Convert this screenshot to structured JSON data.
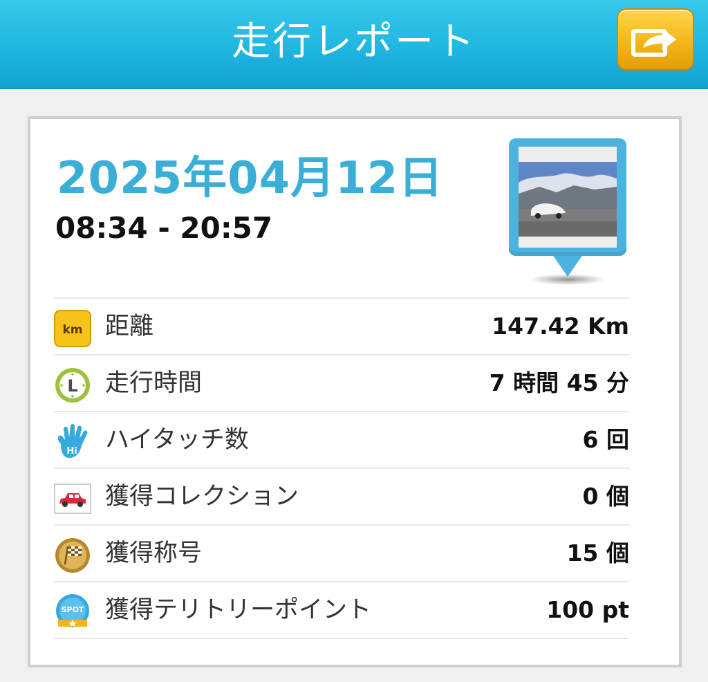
{
  "header": {
    "title": "走行レポート",
    "share_icon": "share-export-icon",
    "bar_color": "#1fb6e0",
    "button_color": "#f3b61a"
  },
  "report": {
    "date": "2025年04月12日",
    "time_range": "08:34 - 20:57",
    "date_color": "#3aaed6",
    "photo_icon": "photo-pin-icon"
  },
  "stats": [
    {
      "icon": "km-icon",
      "icon_text": "km",
      "label": "距離",
      "value": "147.42 Km"
    },
    {
      "icon": "clock-icon",
      "icon_text": "L",
      "label": "走行時間",
      "value": "7 時間 45 分"
    },
    {
      "icon": "hand-hi-icon",
      "icon_text": "Hi",
      "label": "ハイタッチ数",
      "value": "6 回"
    },
    {
      "icon": "car-icon",
      "label": "獲得コレクション",
      "value": "0 個"
    },
    {
      "icon": "flag-badge-icon",
      "label": "獲得称号",
      "value": "15 個"
    },
    {
      "icon": "spot-icon",
      "icon_text": "SPOT",
      "label": "獲得テリトリーポイント",
      "value": "100 pt"
    }
  ]
}
